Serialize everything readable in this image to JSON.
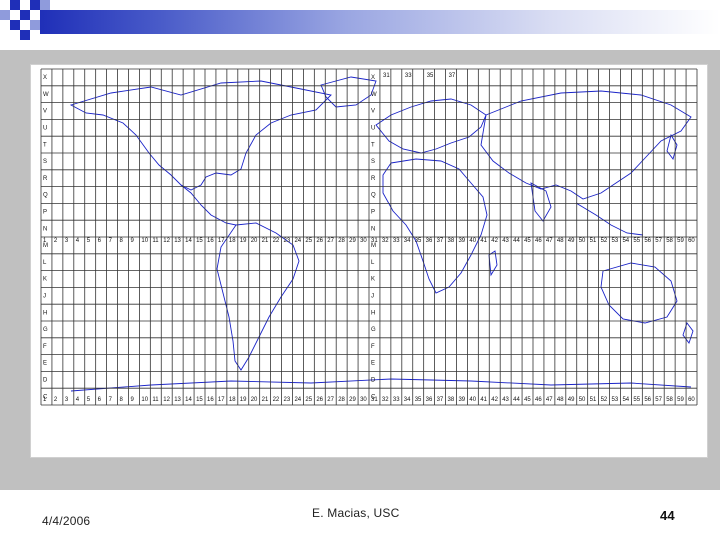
{
  "slide": {
    "date": "4/4/2006",
    "author": "E. Macias, USC",
    "page_number": "44"
  },
  "map": {
    "zone_numbers_left": [
      "1",
      "2",
      "3",
      "4",
      "5",
      "6",
      "7",
      "8",
      "9",
      "10",
      "11",
      "12",
      "13",
      "14",
      "15",
      "16",
      "17",
      "18",
      "19",
      "20",
      "21",
      "22",
      "23",
      "24",
      "25",
      "26",
      "27",
      "28",
      "29",
      "30"
    ],
    "zone_numbers_right": [
      "31",
      "32",
      "33",
      "34",
      "35",
      "36",
      "37",
      "38",
      "39",
      "40",
      "41",
      "42",
      "43",
      "44",
      "45",
      "46",
      "47",
      "48",
      "49",
      "50",
      "51",
      "52",
      "53",
      "54",
      "55",
      "56",
      "57",
      "58",
      "59",
      "60"
    ],
    "band_letters": [
      "X",
      "W",
      "V",
      "U",
      "T",
      "S",
      "R",
      "Q",
      "P",
      "N",
      "M",
      "L",
      "K",
      "J",
      "H",
      "G",
      "F",
      "E",
      "D",
      "C"
    ],
    "top_labels_right": [
      "31",
      "33",
      "35",
      "37"
    ]
  },
  "colors": {
    "banner_blue": "#1f2fb8",
    "map_land": "#1a23c8",
    "grid": "#333333"
  }
}
